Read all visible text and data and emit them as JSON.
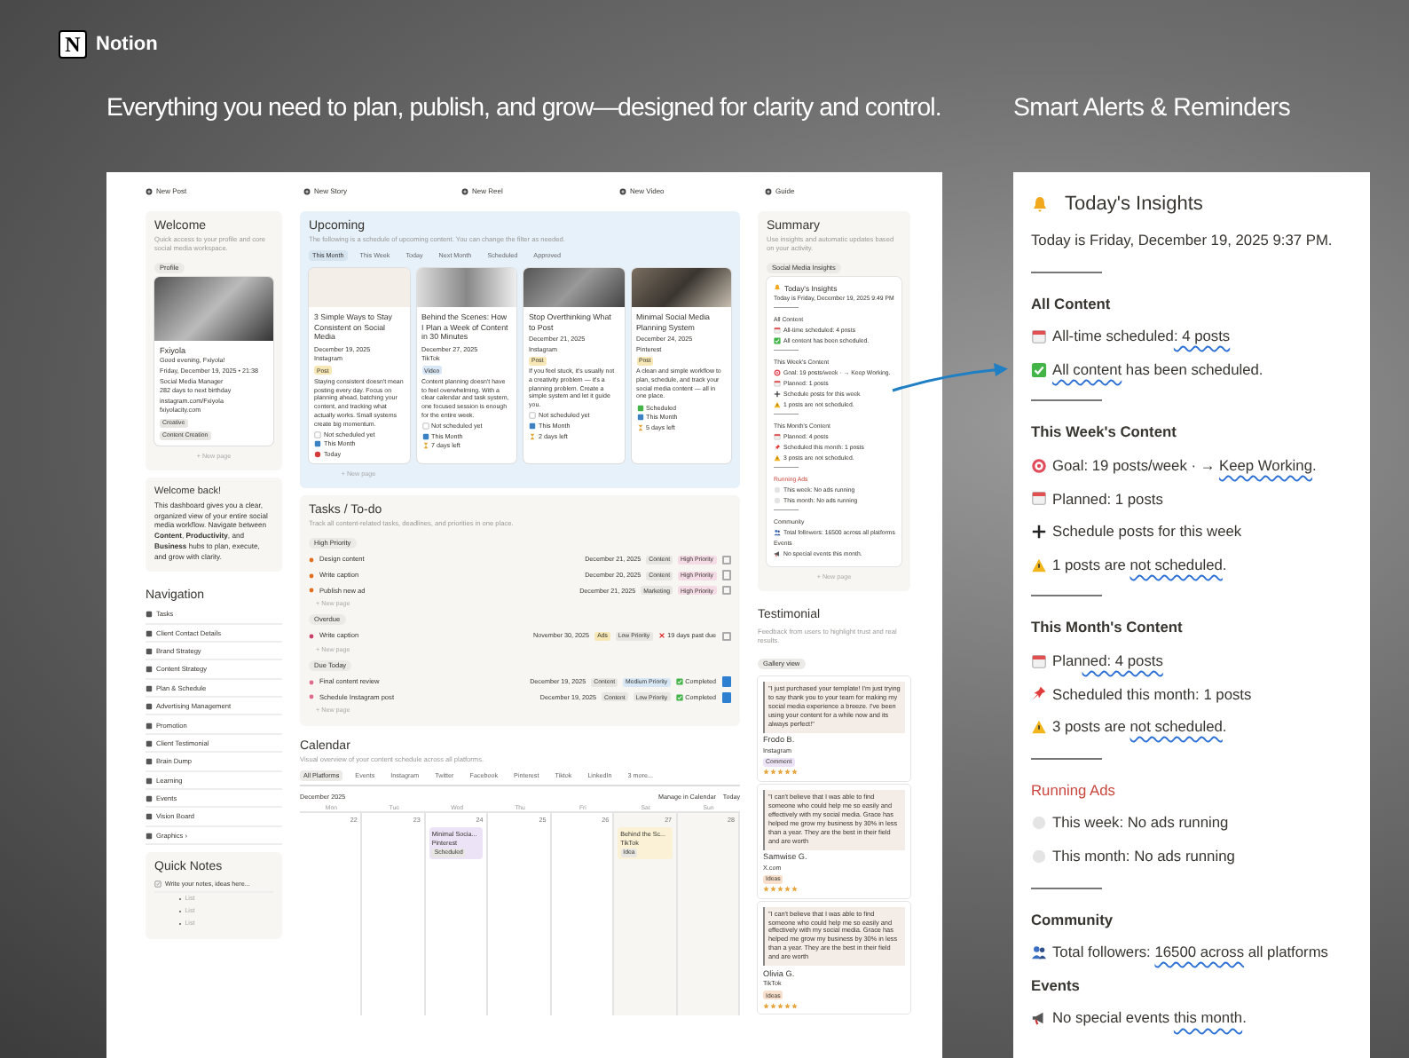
{
  "header": {
    "brand_mark": "N",
    "brand": "Notion",
    "headline": "Everything you need to plan, publish, and grow—designed for clarity and control.",
    "side_title": "Smart Alerts & Reminders"
  },
  "dashboard": {
    "quick_actions": [
      "New Post",
      "New Story",
      "New Reel",
      "New Video",
      "Guide"
    ],
    "welcome": {
      "title": "Welcome",
      "subtitle": "Quick access to your profile and core social media workspace.",
      "tab": "Profile",
      "profile": {
        "name": "Fxiyola",
        "lines": [
          "Good evening, Fxiyola!",
          "Friday, December 19, 2025 • 21:38",
          "Social Media Manager",
          "282 days to next birthday",
          "instagram.com/Fxiyola",
          "fxiyolacity.com"
        ],
        "tags": [
          "Creative",
          "Content Creation"
        ]
      },
      "new_page": "+ New page"
    },
    "welcome_back": {
      "title": "Welcome back!",
      "text": "This dashboard gives you a clear, organized view of your entire social media workflow. Navigate between **Content**, **Productivity**, and **Business** hubs to plan, execute, and grow with clarity."
    },
    "navigation": {
      "title": "Navigation",
      "items": [
        "Tasks",
        "Client Contact Details",
        "Brand Strategy",
        "Content Strategy",
        "Plan & Schedule",
        "Advertising Management",
        "Promotion",
        "Client Testimonial",
        "Brain Dump",
        "Learning",
        "Events",
        "Vision Board",
        "Graphics ›"
      ]
    },
    "quick_notes": {
      "title": "Quick Notes",
      "note": "Write your notes, ideas here...",
      "bullets": [
        "List",
        "List",
        "List"
      ]
    },
    "upcoming": {
      "title": "Upcoming",
      "subtitle": "The following is a schedule of upcoming content. You can change the filter as needed.",
      "tabs": [
        {
          "label": "This Month",
          "selected": true
        },
        {
          "label": "This Week",
          "selected": false
        },
        {
          "label": "Today",
          "selected": false
        },
        {
          "label": "Next Month",
          "selected": false
        },
        {
          "label": "Scheduled",
          "selected": false
        },
        {
          "label": "Approved",
          "selected": false
        }
      ],
      "cards": [
        {
          "title": "3 Simple Ways to Stay Consistent on Social Media",
          "date": "December 19, 2025",
          "platform": "Instagram",
          "tag": {
            "text": "Post",
            "color": "#f6e7b5"
          },
          "text": "Staying consistent doesn't mean posting every day. Focus on planning ahead, batching your content, and tracking what actually works. Small systems create big momentum.",
          "statuses": [
            {
              "kind": "unscheduled",
              "text": "Not scheduled yet"
            },
            {
              "kind": "period",
              "text": "This Month"
            },
            {
              "kind": "due",
              "text": "Today"
            }
          ]
        },
        {
          "title": "Behind the Scenes: How I Plan a Week of Content in 30 Minutes",
          "date": "December 27, 2025",
          "platform": "TikTok",
          "tag": {
            "text": "Video",
            "color": "#d8e7f6"
          },
          "text": "Content planning doesn't have to feel overwhelming. With a clear calendar and task system, one focused session is enough for the entire week.",
          "statuses": [
            {
              "kind": "unscheduled",
              "text": "Not scheduled yet"
            },
            {
              "kind": "period",
              "text": "This Month"
            },
            {
              "kind": "countdown",
              "text": "7 days left"
            }
          ]
        },
        {
          "title": "Stop Overthinking What to Post",
          "date": "December 21, 2025",
          "platform": "Instagram",
          "tag": {
            "text": "Post",
            "color": "#f6e7b5"
          },
          "text": "If you feel stuck, it's usually not a creativity problem — it's a planning problem. Create a simple system and let it guide you.",
          "statuses": [
            {
              "kind": "unscheduled",
              "text": "Not scheduled yet"
            },
            {
              "kind": "period",
              "text": "This Month"
            },
            {
              "kind": "countdown",
              "text": "2 days left"
            }
          ]
        },
        {
          "title": "Minimal Social Media Planning System",
          "date": "December 24, 2025",
          "platform": "Pinterest",
          "tag": {
            "text": "Post",
            "color": "#f6e7b5"
          },
          "text": "A clean and simple workflow to plan, schedule, and track your social media content — all in one place.",
          "statuses": [
            {
              "kind": "scheduled",
              "text": "Scheduled"
            },
            {
              "kind": "period",
              "text": "This Month"
            },
            {
              "kind": "countdown",
              "text": "5 days left"
            }
          ]
        }
      ],
      "new_page": "+ New page"
    },
    "tasks": {
      "title": "Tasks / To-do",
      "subtitle": "Track all content-related tasks, deadlines, and priorities in one place.",
      "groups": [
        {
          "label": "High Priority",
          "color": "#e0701f",
          "rows": [
            {
              "name": "Design content",
              "date": "December 21, 2025",
              "tags": [
                {
                  "text": "Content",
                  "color": "#e8e6e3"
                },
                {
                  "text": "High Priority",
                  "color": "#f5dbe6"
                }
              ],
              "checked": false
            },
            {
              "name": "Write caption",
              "date": "December 20, 2025",
              "tags": [
                {
                  "text": "Content",
                  "color": "#e8e6e3"
                },
                {
                  "text": "High Priority",
                  "color": "#f5dbe6"
                }
              ],
              "checked": false
            },
            {
              "name": "Publish new ad",
              "date": "December 21, 2025",
              "tags": [
                {
                  "text": "Marketing",
                  "color": "#e8e6e3"
                },
                {
                  "text": "High Priority",
                  "color": "#f5dbe6"
                }
              ],
              "checked": false
            }
          ],
          "new_page": "+ New page"
        },
        {
          "label": "Overdue",
          "color": "#c9406a",
          "rows": [
            {
              "name": "Write caption",
              "date": "November 30, 2025",
              "tags": [
                {
                  "text": "Ads",
                  "color": "#f6e7b5"
                },
                {
                  "text": "Low Priority",
                  "color": "#e8e6e3"
                }
              ],
              "kind": "overdue",
              "status": "19 days past due",
              "checked": false
            }
          ],
          "new_page": "+ New page"
        },
        {
          "label": "Due Today",
          "color": "#e06a8a",
          "rows": [
            {
              "name": "Final content review",
              "date": "December 19, 2025",
              "tags": [
                {
                  "text": "Content",
                  "color": "#e8e6e3"
                },
                {
                  "text": "Medium Priority",
                  "color": "#d8e7f6"
                }
              ],
              "kind": "done",
              "status": "Completed",
              "checked": true
            },
            {
              "name": "Schedule Instagram post",
              "date": "December 19, 2025",
              "tags": [
                {
                  "text": "Content",
                  "color": "#e8e6e3"
                },
                {
                  "text": "Low Priority",
                  "color": "#e8e6e3"
                }
              ],
              "kind": "done",
              "status": "Completed",
              "checked": true
            }
          ],
          "new_page": "+ New page"
        }
      ]
    },
    "calendar": {
      "title": "Calendar",
      "subtitle": "Visual overview of your content schedule across all platforms.",
      "tabs": [
        {
          "label": "All Platforms",
          "selected": true
        },
        {
          "label": "Events",
          "selected": false
        },
        {
          "label": "Instagram",
          "selected": false
        },
        {
          "label": "Twitter",
          "selected": false
        },
        {
          "label": "Facebook",
          "selected": false
        },
        {
          "label": "Pinterest",
          "selected": false
        },
        {
          "label": "Tiktok",
          "selected": false
        },
        {
          "label": "LinkedIn",
          "selected": false
        },
        {
          "label": "3 more...",
          "selected": false
        }
      ],
      "month": "December 2025",
      "manage": "Manage in Calendar",
      "today": "Today",
      "weekdays": [
        "Mon",
        "Tue",
        "Wed",
        "Thu",
        "Fri",
        "Sat",
        "Sun"
      ],
      "days": [
        {
          "day": "22",
          "weekend": false
        },
        {
          "day": "23",
          "weekend": false
        },
        {
          "day": "24",
          "weekend": false,
          "events": [
            {
              "title": "Minimal Socia...",
              "platform": "Pinterest",
              "tag": "Scheduled",
              "color": "#ece4f6"
            }
          ]
        },
        {
          "day": "25",
          "weekend": false
        },
        {
          "day": "26",
          "weekend": false
        },
        {
          "day": "27",
          "weekend": true,
          "events": [
            {
              "title": "Behind the Sc...",
              "platform": "TikTok",
              "tag": "Idea",
              "color": "#faf1d6"
            }
          ]
        },
        {
          "day": "28",
          "weekend": true
        }
      ]
    },
    "summary": {
      "title": "Summary",
      "subtitle": "Use insights and automatic updates based on your activity.",
      "tab": "Social Media Insights",
      "insights": {
        "title": "Today's Insights",
        "date": "Today is Friday, December 19, 2025 9:49 PM",
        "sections": [
          {
            "title": "All Content",
            "alert": false,
            "divider": true,
            "lines": [
              {
                "kind": "calendar",
                "text": "All-time scheduled: 4 posts"
              },
              {
                "kind": "check",
                "text": "All content has been scheduled."
              }
            ]
          },
          {
            "title": "This Week's Content",
            "alert": false,
            "divider": true,
            "lines": [
              {
                "kind": "goal",
                "text": "Goal: 19 posts/week · → Keep Working."
              },
              {
                "kind": "calendar",
                "text": "Planned: 1 posts"
              },
              {
                "kind": "add",
                "text": "Schedule posts for this week"
              },
              {
                "kind": "warning",
                "text": "1 posts are not scheduled."
              }
            ]
          },
          {
            "title": "This Month's Content",
            "alert": false,
            "divider": true,
            "lines": [
              {
                "kind": "calendar",
                "text": "Planned: 4 posts"
              },
              {
                "kind": "pin",
                "text": "Scheduled this month: 1 posts"
              },
              {
                "kind": "warning",
                "text": "3 posts are not scheduled."
              }
            ]
          },
          {
            "title": "Running Ads",
            "alert": true,
            "divider": true,
            "lines": [
              {
                "kind": "idle",
                "text": "This week: No ads running"
              },
              {
                "kind": "idle",
                "text": "This month: No ads running"
              }
            ]
          },
          {
            "title": "Community",
            "alert": false,
            "divider": true,
            "lines": [
              {
                "kind": "people",
                "text": "Total followers: 16500 across all platforms"
              }
            ]
          },
          {
            "title": "Events",
            "alert": false,
            "divider": false,
            "lines": [
              {
                "kind": "announce",
                "text": "No special events this month."
              }
            ]
          }
        ]
      },
      "new_page": "+ New page"
    },
    "testimonial": {
      "title": "Testimonial",
      "subtitle": "Feedback from users to highlight trust and real results.",
      "view": "Gallery view",
      "cards": [
        {
          "quote": "\"I just purchased your template! I'm just trying to say thank you to your team for making my social media experience a breeze. I've been using your content for a while now and its always perfect!\"",
          "name": "Frodo B.",
          "platform": "Instagram",
          "tag": {
            "text": "Comment",
            "color": "#ece4f6"
          },
          "stars": 5
        },
        {
          "quote": "\"I can't believe that I was able to find someone who could help me so easily and effectively with my social media. Grace has helped me grow my business by 30% in less than a year. They are the best in their field and are worth",
          "name": "Samwise G.",
          "platform": "X.com",
          "tag": {
            "text": "Ideas",
            "color": "#f8e0cc"
          },
          "stars": 5
        },
        {
          "quote": "\"I can't believe that I was able to find someone who could help me so easily and effectively with my social media. Grace has helped me grow my business by 30% in less than a year. They are the best in their field and are worth",
          "name": "Olivia G.",
          "platform": "TikTok",
          "tag": {
            "text": "Ideas",
            "color": "#f8e0cc"
          },
          "stars": 5
        }
      ]
    }
  },
  "right_panel": {
    "title": "Today's Insights",
    "date": "Today is Friday, December 19, 2025 9:37 PM.",
    "sections": [
      {
        "title": "All Content",
        "alert": false,
        "divider": true,
        "lines": [
          {
            "kind": "calendar",
            "text": "All-time scheduled",
            "marked": ": 4 posts"
          },
          {
            "kind": "check",
            "marked": "All content",
            "after": " has been scheduled."
          }
        ]
      },
      {
        "title": "This Week's Content",
        "alert": false,
        "divider": true,
        "lines": [
          {
            "kind": "goal",
            "text": "Goal: 19 posts/week · → ",
            "marked": "Keep Working",
            "after": "."
          },
          {
            "kind": "calendar",
            "text": "Planned: 1 posts"
          },
          {
            "kind": "add",
            "text": "Schedule posts for this week"
          },
          {
            "kind": "warning",
            "text": "1 posts are ",
            "marked": "not scheduled",
            "after": "."
          }
        ]
      },
      {
        "title": "This Month's Content",
        "alert": false,
        "divider": true,
        "lines": [
          {
            "kind": "calendar",
            "text": "Plan",
            "marked": "ned: 4 posts"
          },
          {
            "kind": "pin",
            "text": "Scheduled this month: 1 posts"
          },
          {
            "kind": "warning",
            "text": "3 posts are ",
            "marked": "not scheduled",
            "after": "."
          }
        ]
      },
      {
        "title": "Running Ads",
        "alert": true,
        "divider": true,
        "lines": [
          {
            "kind": "idle",
            "text": "This week: No ads running"
          },
          {
            "kind": "idle",
            "text": "This month: No ads running"
          }
        ]
      },
      {
        "title": "Community",
        "alert": false,
        "divider": true,
        "lines": [
          {
            "kind": "people",
            "text": "Total followers: ",
            "marked": "16500 across",
            "after": " all platforms"
          }
        ]
      },
      {
        "title": "Events",
        "alert": false,
        "divider": false,
        "lines": [
          {
            "kind": "announce",
            "text": "No special events ",
            "marked": "this month",
            "after": "."
          }
        ]
      }
    ]
  }
}
